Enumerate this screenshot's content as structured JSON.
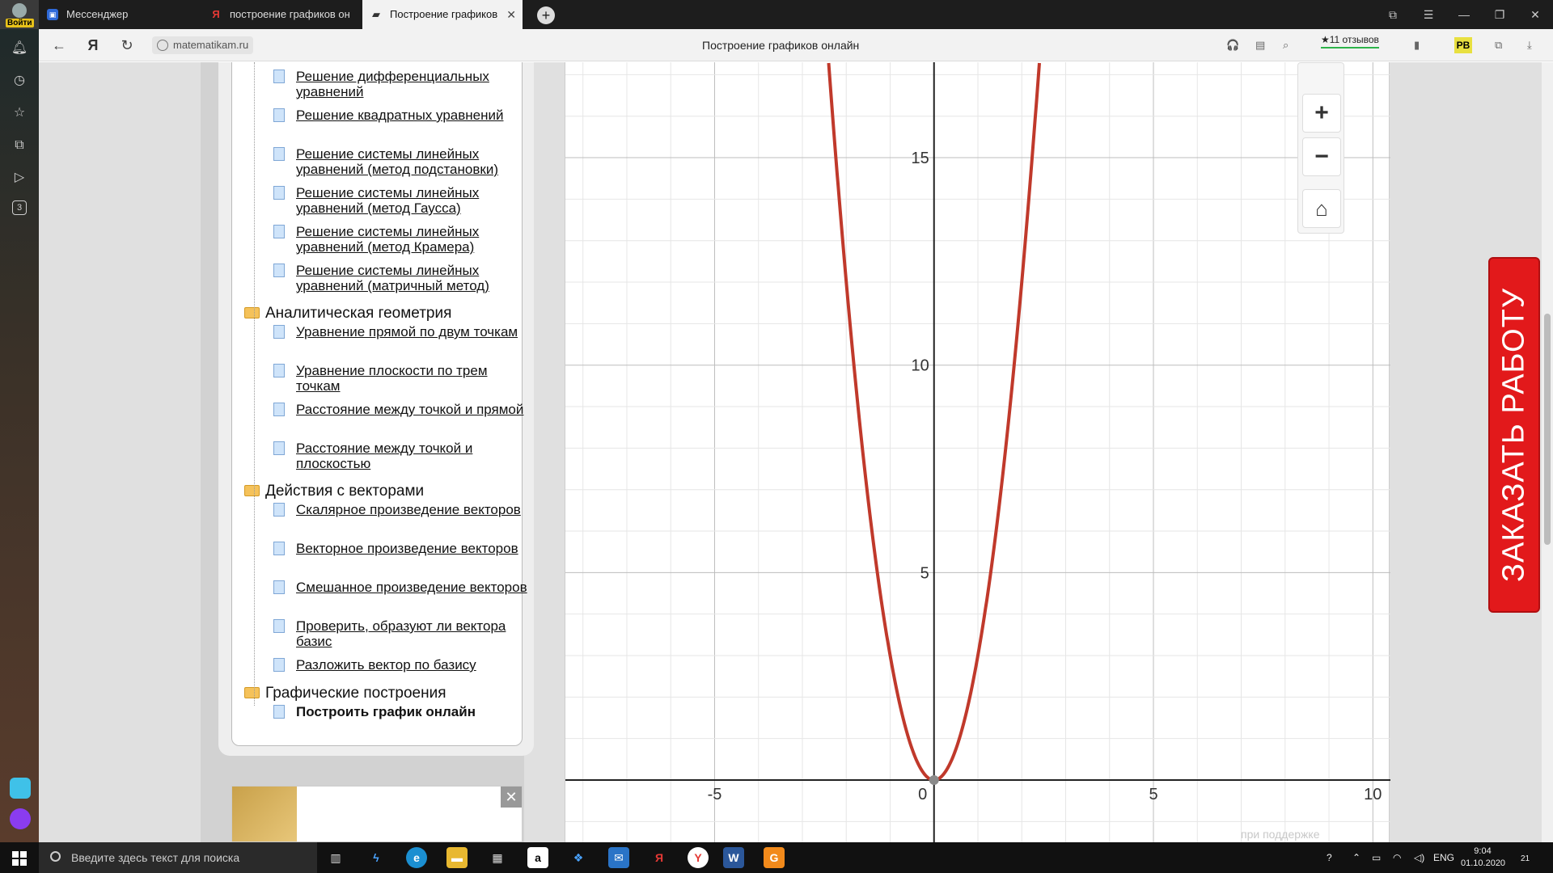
{
  "browser": {
    "login_label": "Войти",
    "tabs": [
      {
        "label": "Мессенджер"
      },
      {
        "label": "построение графиков он"
      },
      {
        "label": "Построение графиков",
        "active": true
      }
    ],
    "new_tab_symbol": "+",
    "url": "matematikam.ru",
    "page_title": "Построение графиков онлайн",
    "reviews_label": "★11 отзывов",
    "rb_badge": "РВ",
    "window_controls": [
      "⧉",
      "☰",
      "—",
      "❐",
      "✕"
    ]
  },
  "sidebar_icons": [
    "bell-icon",
    "history-icon",
    "star-icon",
    "collections-icon",
    "play-icon",
    "tabs-count-icon"
  ],
  "sidebar_tab_count": "3",
  "menu": {
    "items": [
      {
        "type": "doc",
        "label": "Решение дифференциальных уравнений"
      },
      {
        "type": "doc",
        "label": "Решение квадратных уравнений"
      },
      {
        "type": "doc",
        "label": "Решение системы линейных уравнений (метод подстановки)"
      },
      {
        "type": "doc",
        "label": "Решение системы линейных уравнений (метод Гаусса)"
      },
      {
        "type": "doc",
        "label": "Решение системы линейных уравнений (метод Крамера)"
      },
      {
        "type": "doc",
        "label": "Решение системы линейных уравнений (матричный метод)"
      },
      {
        "type": "folder",
        "label": "Аналитическая геометрия"
      },
      {
        "type": "doc",
        "label": "Уравнение прямой по двум точкам"
      },
      {
        "type": "doc",
        "label": "Уравнение плоскости по трем точкам"
      },
      {
        "type": "doc",
        "label": "Расстояние между точкой и прямой"
      },
      {
        "type": "doc",
        "label": "Расстояние между точкой и плоскостью"
      },
      {
        "type": "folder",
        "label": "Действия с векторами"
      },
      {
        "type": "doc",
        "label": "Скалярное произведение векторов"
      },
      {
        "type": "doc",
        "label": "Векторное произведение векторов"
      },
      {
        "type": "doc",
        "label": "Смешанное произведение векторов"
      },
      {
        "type": "doc",
        "label": "Проверить, образуют ли вектора базис"
      },
      {
        "type": "doc",
        "label": "Разложить вектор по базису"
      },
      {
        "type": "folder",
        "label": "Графические построения"
      },
      {
        "type": "doc",
        "label": "Построить график онлайн",
        "current": true
      }
    ]
  },
  "ad": {
    "close_symbol": "✕"
  },
  "graph": {
    "controls": {
      "zoom_in": "+",
      "zoom_out": "−",
      "home": "⌂"
    },
    "note": "при поддержке"
  },
  "chart_data": {
    "type": "line",
    "function": "y = 3x^2",
    "series": [
      {
        "color": "#c0392b",
        "x": [
          -2.4,
          -2.0,
          -1.5,
          -1.0,
          -0.5,
          0,
          0.5,
          1.0,
          1.5,
          2.0,
          2.4
        ],
        "y": [
          17.28,
          12,
          6.75,
          3,
          0.75,
          0,
          0.75,
          3,
          6.75,
          12,
          17.28
        ]
      }
    ],
    "xlim": [
      -8.4,
      10.4
    ],
    "ylim": [
      -1.5,
      17.3
    ],
    "x_ticks": [
      -5,
      0,
      5,
      10
    ],
    "y_ticks": [
      5,
      10,
      15
    ],
    "x_tick_labels": [
      "-5",
      "0",
      "5",
      "10"
    ],
    "y_tick_labels": [
      "5",
      "10",
      "15"
    ],
    "grid": true,
    "minor_step": 1,
    "major_step": 5
  },
  "order_banner": "ЗАКАЗАТЬ РАБОТУ",
  "taskbar": {
    "search_placeholder": "Введите здесь текст для поиска",
    "lang": "ENG",
    "time": "9:04",
    "date": "01.10.2020",
    "notif_count": "21"
  }
}
